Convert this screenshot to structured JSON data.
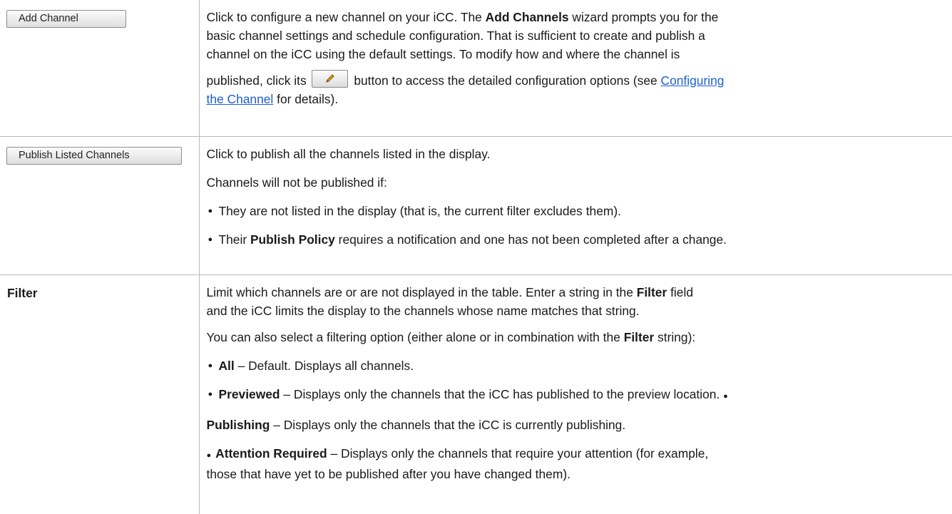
{
  "rows": [
    {
      "button_label": "Add Channel",
      "text": [
        "Click to configure a new channel on your iCC. The ",
        "Add Channels",
        " wizard prompts you for the",
        "basic channel settings and schedule configuration. That is sufficient to create and publish a",
        "channel on the iCC using the default settings. To modify how and where the channel is",
        "published, click its ",
        " button to access the detailed configuration options (see ",
        "Configuring",
        "the Channel",
        " for details)."
      ]
    },
    {
      "button_label": "Publish Listed Channels",
      "intro": "Click to publish all the channels listed in the display.",
      "condition_lead": "Channels will not be published if:",
      "bullets": [
        {
          "pre": "They are not listed in the display (that is, the current filter excludes them).",
          "bold": "",
          "post": ""
        },
        {
          "pre": "Their ",
          "bold": "Publish Policy",
          "post": " requires a notification and one has not been completed after a change."
        }
      ]
    },
    {
      "label": "Filter",
      "line1_pre": "Limit which channels are or are not displayed in the table. Enter a string in the ",
      "line1_bold": "Filter",
      "line1_post": " field",
      "line2": "and the iCC limits the display to the channels whose name matches that string.",
      "option_lead_pre": "You can also select a filtering option (either alone or in combination with the ",
      "option_lead_bold": "Filter",
      "option_lead_post": " string):",
      "opt_all_bold": "All",
      "opt_all_text": " – Default. Displays all channels.",
      "opt_previewed_bold": "Previewed",
      "opt_previewed_text": " – Displays only the channels that the iCC has published to the preview location. ",
      "opt_publishing_bold": "Publishing",
      "opt_publishing_text": " – Displays only the channels that the iCC is currently publishing.",
      "opt_attention_bold": "Attention Required",
      "opt_attention_text": " – Displays only the channels that require your attention (for example,",
      "opt_attention_cont": "those that have yet to be published after you have changed them)."
    }
  ],
  "bullet_glyph": "●",
  "colors": {
    "link": "#1b5fd1",
    "border": "#b8b8b8"
  },
  "icons": {
    "edit": "pencil-icon"
  }
}
